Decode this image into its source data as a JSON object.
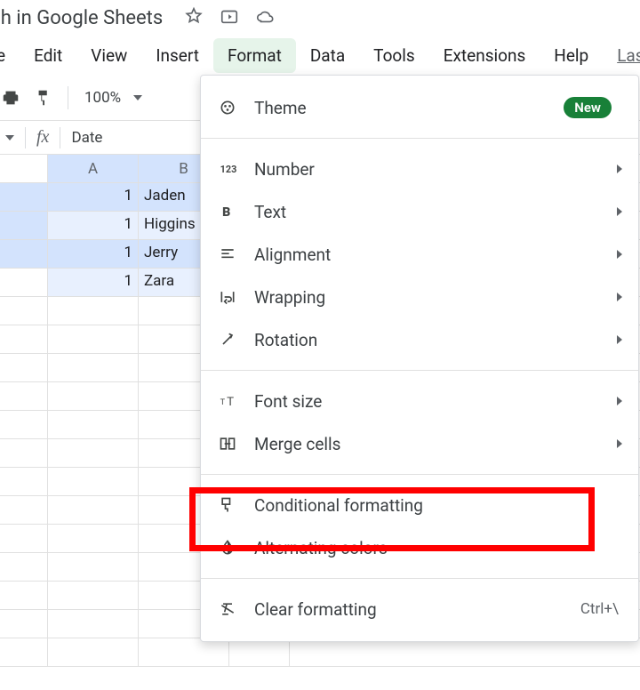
{
  "title": "arch in Google Sheets",
  "menubar": {
    "items": [
      "e",
      "Edit",
      "View",
      "Insert",
      "Format",
      "Data",
      "Tools",
      "Extensions",
      "Help",
      "Last"
    ],
    "active_index": 4
  },
  "toolbar": {
    "zoom": "100%"
  },
  "formula_bar": {
    "fx": "fx",
    "value": "Date"
  },
  "grid": {
    "columns": [
      "A",
      "B"
    ],
    "rows": [
      {
        "a": "1",
        "b": "Jaden",
        "sel": "sel"
      },
      {
        "a": "1",
        "b": "Higgins",
        "sel": "sel2"
      },
      {
        "a": "1",
        "b": "Jerry",
        "sel": "sel"
      },
      {
        "a": "1",
        "b": "Zara",
        "sel": "sel2"
      }
    ]
  },
  "dropdown": {
    "theme": "Theme",
    "badge_new": "New",
    "number": "Number",
    "text": "Text",
    "alignment": "Alignment",
    "wrapping": "Wrapping",
    "rotation": "Rotation",
    "font_size": "Font size",
    "merge_cells": "Merge cells",
    "conditional_formatting": "Conditional formatting",
    "alternating_colors": "Alternating colors",
    "clear_formatting": "Clear formatting",
    "clear_shortcut": "Ctrl+\\"
  }
}
